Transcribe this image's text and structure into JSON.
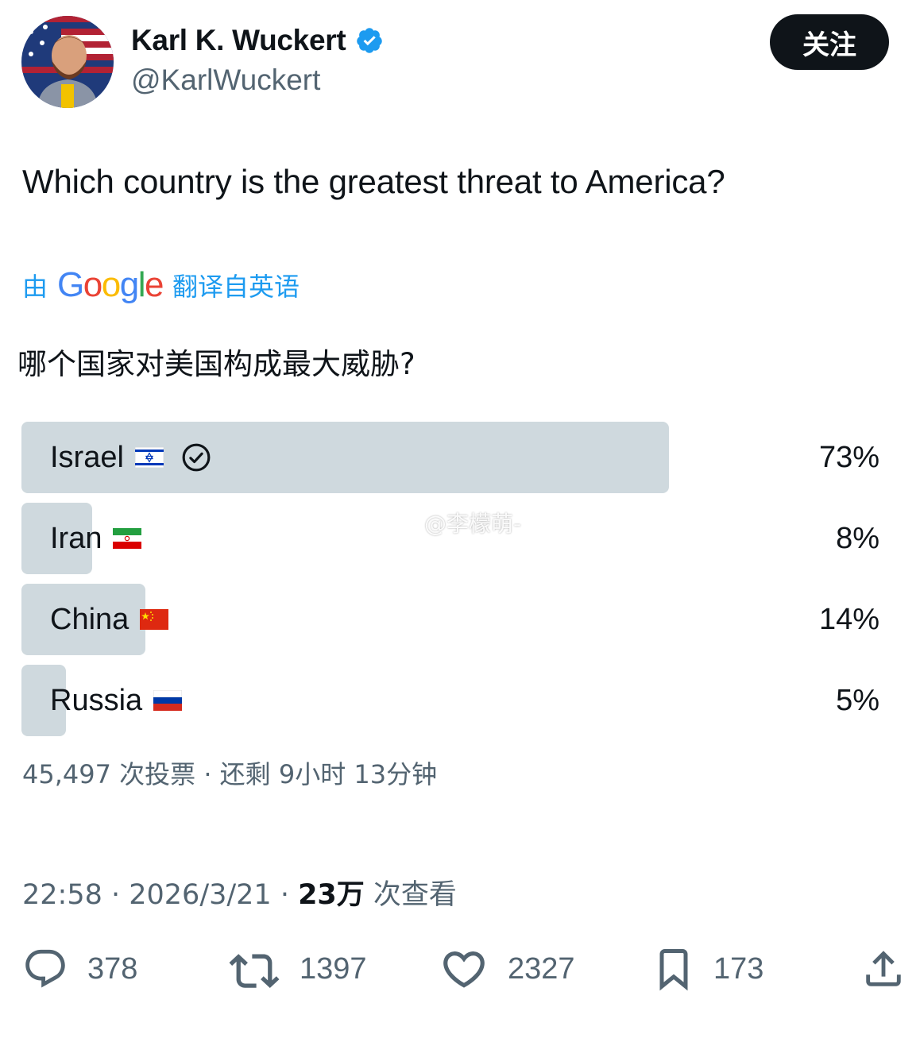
{
  "author": {
    "name": "Karl K. Wuckert",
    "handle": "@KarlWuckert",
    "verified": true,
    "follow_label": "关注"
  },
  "tweet": {
    "text": "Which country is the greatest threat to America?",
    "translation_prefix": "由",
    "translation_brand": "Google",
    "translation_suffix": "翻译自英语",
    "translated_text": "哪个国家对美国构成最大威胁?"
  },
  "poll": {
    "options": [
      {
        "label": "Israel",
        "percent": "73%",
        "fraction": 0.73,
        "flag_icon": "israel-flag-icon",
        "selected": true
      },
      {
        "label": "Iran",
        "percent": "8%",
        "fraction": 0.08,
        "flag_icon": "iran-flag-icon",
        "selected": false
      },
      {
        "label": "China",
        "percent": "14%",
        "fraction": 0.14,
        "flag_icon": "china-flag-icon",
        "selected": false
      },
      {
        "label": "Russia",
        "percent": "5%",
        "fraction": 0.05,
        "flag_icon": "russia-flag-icon",
        "selected": false
      }
    ],
    "meta": "45,497 次投票 · 还剩 9小时 13分钟"
  },
  "timestamp": {
    "time_date": "22:58 · 2026/3/21 · ",
    "views_count": "23万",
    "views_label": " 次查看"
  },
  "watermark": "@李檬萌-",
  "actions": {
    "replies": "378",
    "reposts": "1397",
    "likes": "2327",
    "bookmarks": "173"
  },
  "colors": {
    "accent": "#1d9bf0",
    "bar": "#cfd9de",
    "muted": "#536471",
    "text": "#0f1419"
  }
}
